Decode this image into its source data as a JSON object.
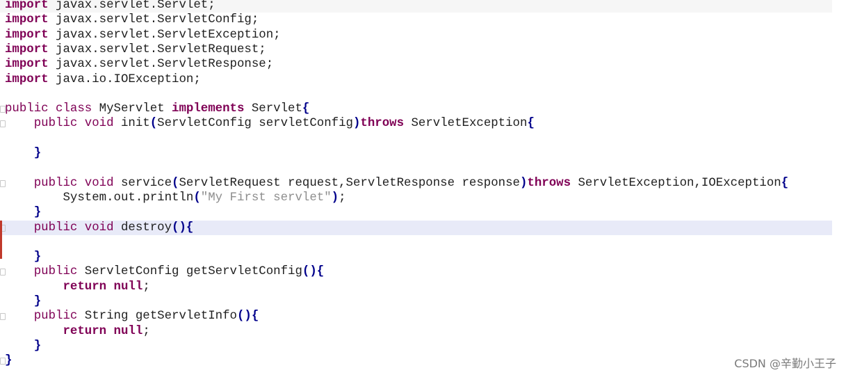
{
  "editor": {
    "lines": [
      [
        {
          "t": "import",
          "c": "key"
        },
        {
          "t": " javax.servlet.Servlet;",
          "c": "pl"
        }
      ],
      [
        {
          "t": "import",
          "c": "key"
        },
        {
          "t": " javax.servlet.ServletConfig;",
          "c": "pl"
        }
      ],
      [
        {
          "t": "import",
          "c": "key"
        },
        {
          "t": " javax.servlet.ServletException;",
          "c": "pl"
        }
      ],
      [
        {
          "t": "import",
          "c": "key"
        },
        {
          "t": " javax.servlet.ServletRequest;",
          "c": "pl"
        }
      ],
      [
        {
          "t": "import",
          "c": "key"
        },
        {
          "t": " javax.servlet.ServletResponse;",
          "c": "pl"
        }
      ],
      [
        {
          "t": "import",
          "c": "key"
        },
        {
          "t": " java.io.IOException;",
          "c": "pl"
        }
      ],
      [],
      [
        {
          "t": "public class",
          "c": "kw"
        },
        {
          "t": " MyServlet ",
          "c": "pl"
        },
        {
          "t": "implements",
          "c": "key"
        },
        {
          "t": " Servlet",
          "c": "pl"
        },
        {
          "t": "{",
          "c": "pun"
        }
      ],
      [
        {
          "t": "    public void",
          "c": "kw"
        },
        {
          "t": " init",
          "c": "pl"
        },
        {
          "t": "(",
          "c": "pun"
        },
        {
          "t": "ServletConfig servletConfig",
          "c": "pl"
        },
        {
          "t": ")",
          "c": "pun"
        },
        {
          "t": "throws",
          "c": "key"
        },
        {
          "t": " ServletException",
          "c": "pl"
        },
        {
          "t": "{",
          "c": "pun"
        }
      ],
      [],
      [
        {
          "t": "    ",
          "c": "pl"
        },
        {
          "t": "}",
          "c": "pun"
        }
      ],
      [],
      [
        {
          "t": "    public void",
          "c": "kw"
        },
        {
          "t": " service",
          "c": "pl"
        },
        {
          "t": "(",
          "c": "pun"
        },
        {
          "t": "ServletRequest request,ServletResponse response",
          "c": "pl"
        },
        {
          "t": ")",
          "c": "pun"
        },
        {
          "t": "throws",
          "c": "key"
        },
        {
          "t": " ServletException,IOException",
          "c": "pl"
        },
        {
          "t": "{",
          "c": "pun"
        }
      ],
      [
        {
          "t": "        System.out.println",
          "c": "pl"
        },
        {
          "t": "(",
          "c": "pun"
        },
        {
          "t": "\"My First servlet\"",
          "c": "str2"
        },
        {
          "t": ")",
          "c": "pun"
        },
        {
          "t": ";",
          "c": "pl"
        }
      ],
      [
        {
          "t": "    ",
          "c": "pl"
        },
        {
          "t": "}",
          "c": "pun"
        }
      ],
      [
        {
          "t": "    public void",
          "c": "kw"
        },
        {
          "t": " destroy",
          "c": "pl"
        },
        {
          "t": "(){",
          "c": "pun"
        }
      ],
      [],
      [
        {
          "t": "    ",
          "c": "pl"
        },
        {
          "t": "}",
          "c": "pun"
        }
      ],
      [
        {
          "t": "    public",
          "c": "kw"
        },
        {
          "t": " ServletConfig getServletConfig",
          "c": "pl"
        },
        {
          "t": "(){",
          "c": "pun"
        }
      ],
      [
        {
          "t": "        ",
          "c": "pl"
        },
        {
          "t": "return null",
          "c": "key"
        },
        {
          "t": ";",
          "c": "pl"
        }
      ],
      [
        {
          "t": "    ",
          "c": "pl"
        },
        {
          "t": "}",
          "c": "pun"
        }
      ],
      [
        {
          "t": "    public",
          "c": "kw"
        },
        {
          "t": " String getServletInfo",
          "c": "pl"
        },
        {
          "t": "(){",
          "c": "pun"
        }
      ],
      [
        {
          "t": "        ",
          "c": "pl"
        },
        {
          "t": "return null",
          "c": "key"
        },
        {
          "t": ";",
          "c": "pl"
        }
      ],
      [
        {
          "t": "    ",
          "c": "pl"
        },
        {
          "t": "}",
          "c": "pun"
        }
      ],
      [
        {
          "t": "}",
          "c": "pun"
        }
      ]
    ],
    "highlighted_line": 15,
    "faint_line": 0,
    "fold_markers": [
      7,
      8,
      12,
      15,
      18,
      21,
      24
    ],
    "colors": {
      "keyword": "#7f0055",
      "punctuation": "#00008b",
      "string": "#8e8e8e",
      "current_line": "#e8eaf8",
      "change_bar": "#c0392b"
    }
  },
  "watermark": "CSDN @辛勤小王子"
}
